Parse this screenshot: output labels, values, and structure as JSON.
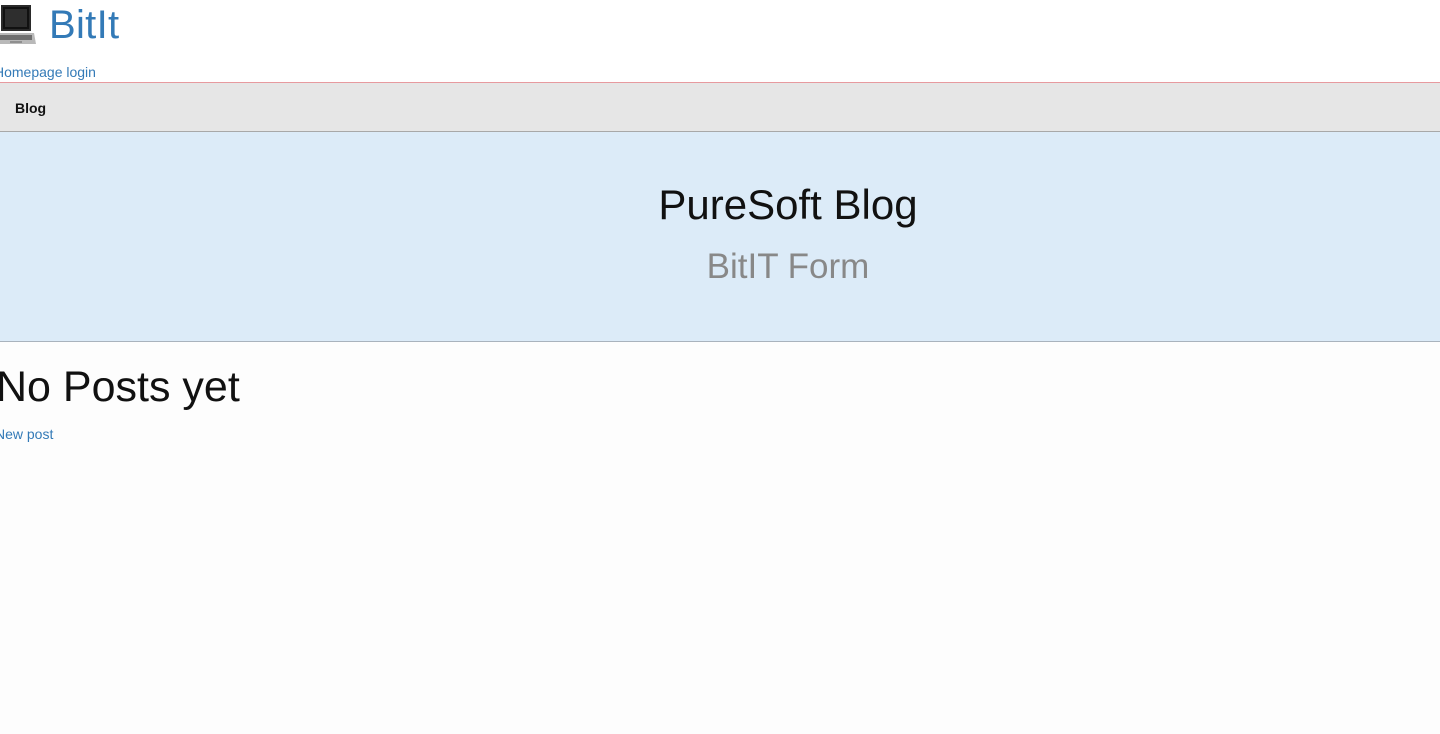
{
  "header": {
    "brand": "BitIt",
    "home_login_link": "Homepage login",
    "logo_icon": "laptop-icon"
  },
  "navbar": {
    "items": [
      {
        "label": "Blog"
      }
    ]
  },
  "hero": {
    "title": "PureSoft Blog",
    "subtitle": "BitIT Form"
  },
  "content": {
    "heading": "No Posts yet",
    "new_post_link": "New post"
  },
  "colors": {
    "link": "#337ab7",
    "navbar_bg": "#e6e6e6",
    "hero_bg": "#dcebf8",
    "header_border": "#e79a9f"
  }
}
